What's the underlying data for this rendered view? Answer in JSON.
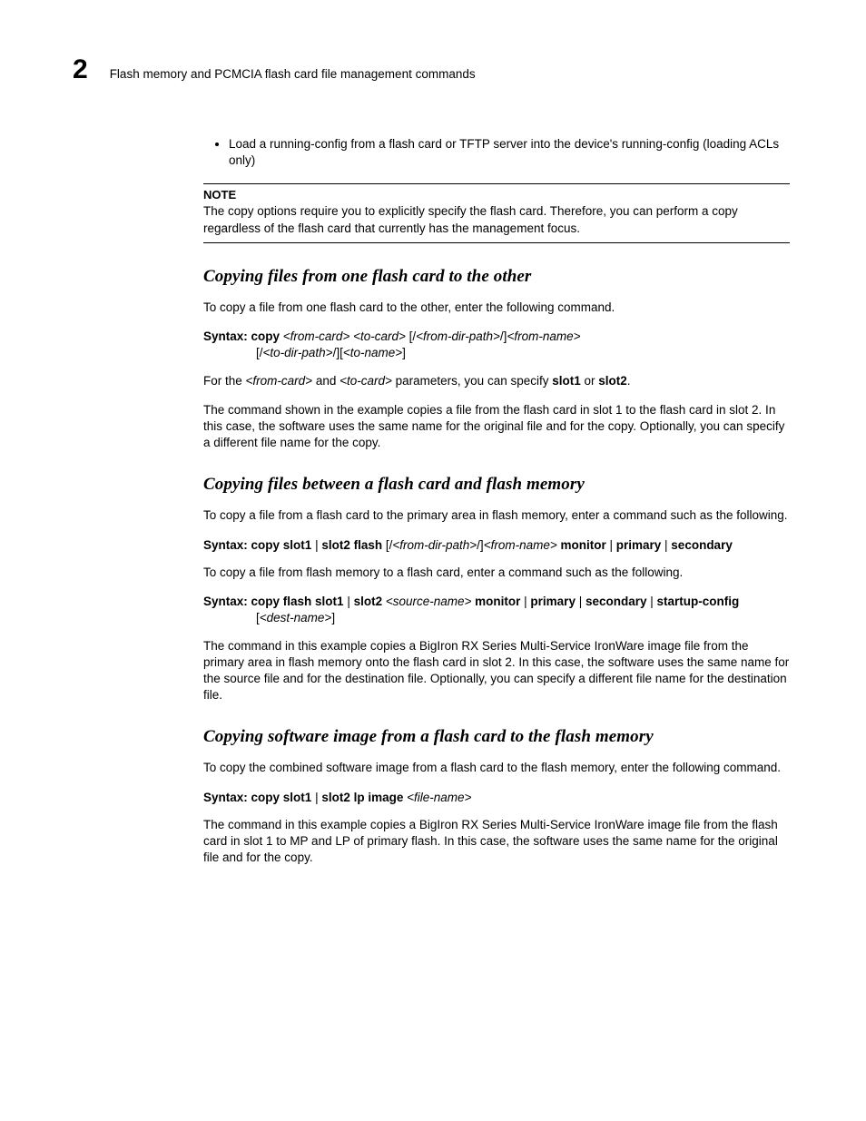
{
  "header": {
    "chapter_number": "2",
    "running_head": "Flash memory and PCMCIA flash card file management commands"
  },
  "bullet_item": "Load a running-config from a flash card or TFTP server into the device's running-config (loading ACLs only)",
  "note": {
    "label": "NOTE",
    "text": "The copy options require you to explicitly specify the flash card. Therefore, you can perform a copy regardless of the flash card that currently has the management focus."
  },
  "sections": {
    "s1": {
      "title": "Copying files from one flash card to the other",
      "intro": "To copy a file from one flash card to the other, enter the following command.",
      "syntax": {
        "label": "Syntax:  ",
        "cmd": "copy ",
        "args1_ital": "<from-card> <to-card> ",
        "args1_plain": "[/",
        "args1_ital2": "<from-dir-path>",
        "args1_plain2": "/]",
        "args1_ital3": "<from-name>",
        "line2_plain1": "[/",
        "line2_ital1": "<to-dir-path>",
        "line2_plain2": "/][",
        "line2_ital2": "<to-name>",
        "line2_plain3": "]"
      },
      "para1_a": "For the ",
      "para1_ital1": "<from-card>",
      "para1_b": " and ",
      "para1_ital2": "<to-card>",
      "para1_c": " parameters, you can specify ",
      "para1_bold1": "slot1",
      "para1_d": " or ",
      "para1_bold2": "slot2",
      "para1_e": ".",
      "para2": "The command shown in the example copies a file from the flash card in slot 1 to the flash card in slot 2. In this case, the software uses the same name for the original file and for the copy. Optionally, you can specify a different file name for the copy."
    },
    "s2": {
      "title": "Copying files between a flash card and flash memory",
      "intro": "To copy a file from a flash card to the primary area in flash memory, enter a command such as the following.",
      "syntax1": {
        "label": "Syntax:  ",
        "b1": "copy slot1 ",
        "p1": "| ",
        "b2": "slot2 flash ",
        "p2": "[/",
        "i1": "<from-dir-path>",
        "p3": "/]",
        "i2": "<from-name> ",
        "b3": "monitor ",
        "p4": "| ",
        "b4": "primary ",
        "p5": "| ",
        "b5": "secondary"
      },
      "mid": "To copy a file from flash memory to a flash card, enter a command such as the following.",
      "syntax2": {
        "label": "Syntax:  ",
        "b1": "copy flash slot1 ",
        "p1": "| ",
        "b2": "slot2 ",
        "i1": "<source-name> ",
        "b3": "monitor ",
        "p2": "| ",
        "b4": "primary ",
        "p3": "| ",
        "b5": "secondary ",
        "p4": "| ",
        "b6": "startup-config",
        "line2_p1": "[",
        "line2_i1": "<dest-name>",
        "line2_p2": "]"
      },
      "para": "The command in this example copies a BigIron RX Series Multi-Service IronWare image file from the primary area in flash memory onto the flash card in slot 2. In this case, the software uses the same name for the source file and for the destination file. Optionally, you can specify a different file name for the destination file."
    },
    "s3": {
      "title": "Copying software image from a flash card to the flash memory",
      "intro": "To copy the combined software image from a flash card to the flash memory, enter the following command.",
      "syntax": {
        "label": "Syntax:  ",
        "b1": "copy slot1 ",
        "p1": "| ",
        "b2": "slot2 lp image ",
        "i1": "<file-name>"
      },
      "para": "The command in this example copies a BigIron RX Series Multi-Service IronWare image file from the flash card in slot 1 to MP and LP of primary flash. In this case, the software uses the same name for the original file and for the copy."
    }
  }
}
